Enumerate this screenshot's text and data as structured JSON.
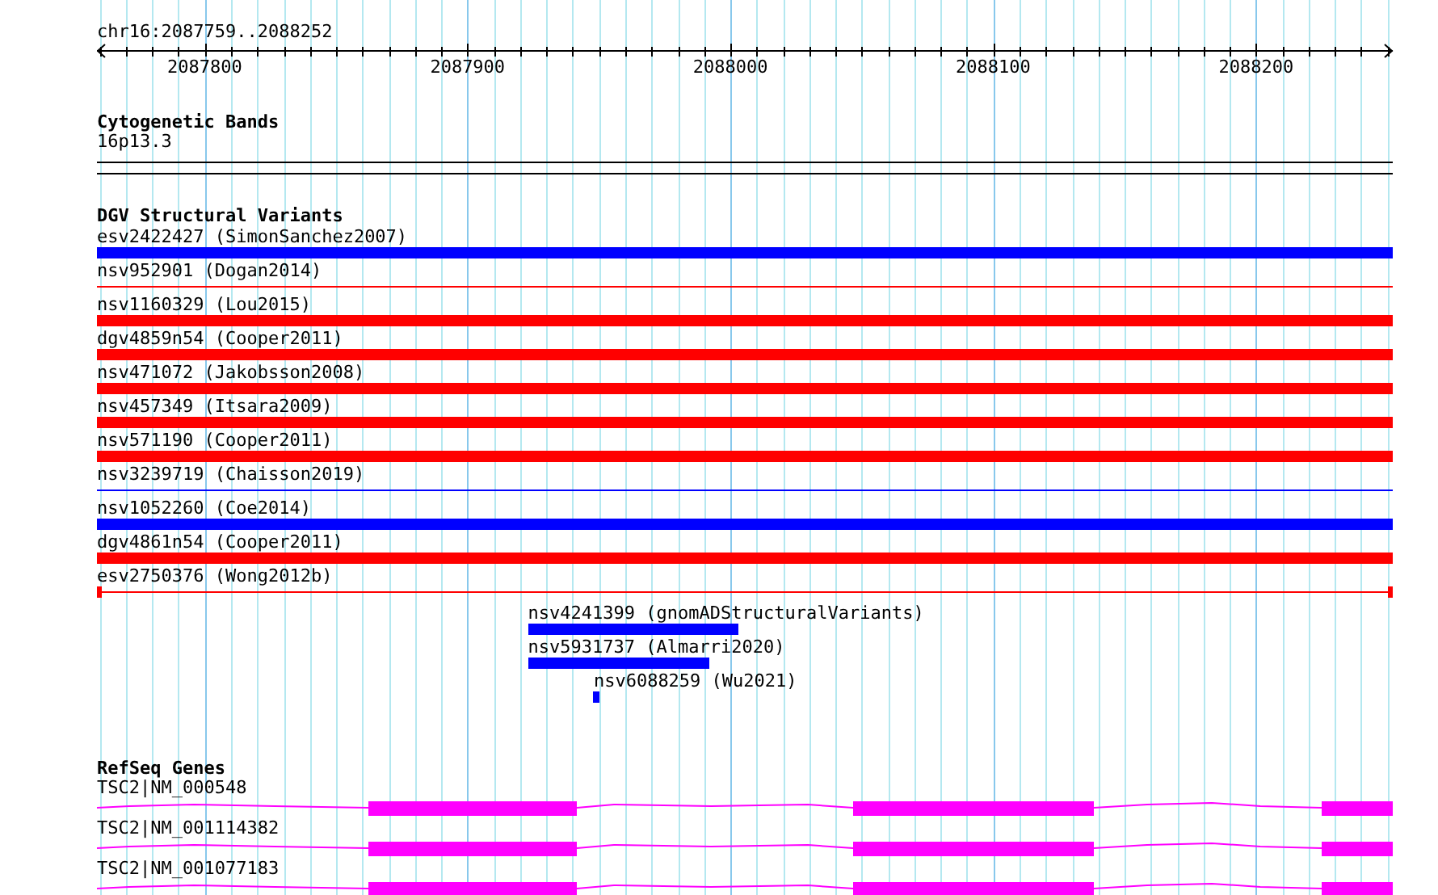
{
  "location": "chr16:2087759..2088252",
  "axis": {
    "ticks": [
      "2087800",
      "2087900",
      "2088000",
      "2088100",
      "2088200"
    ]
  },
  "tracks": [
    {
      "kind": "bands",
      "title": "Cytogenetic Bands",
      "features": [
        {
          "label": "16p13.3"
        }
      ]
    },
    {
      "kind": "variants",
      "title": "DGV Structural Variants",
      "features": [
        {
          "label": "esv2422427 (SimonSanchez2007)",
          "color": "#0000ff",
          "kind": "bar"
        },
        {
          "label": "nsv952901 (Dogan2014)",
          "color": "#ff0000",
          "kind": "line"
        },
        {
          "label": "nsv1160329 (Lou2015)",
          "color": "#ff0000",
          "kind": "bar"
        },
        {
          "label": "dgv4859n54 (Cooper2011)",
          "color": "#ff0000",
          "kind": "bar"
        },
        {
          "label": "nsv471072 (Jakobsson2008)",
          "color": "#ff0000",
          "kind": "bar"
        },
        {
          "label": "nsv457349 (Itsara2009)",
          "color": "#ff0000",
          "kind": "bar"
        },
        {
          "label": "nsv571190 (Cooper2011)",
          "color": "#ff0000",
          "kind": "bar"
        },
        {
          "label": "nsv3239719 (Chaisson2019)",
          "color": "#0000ff",
          "kind": "line"
        },
        {
          "label": "nsv1052260 (Coe2014)",
          "color": "#0000ff",
          "kind": "bar"
        },
        {
          "label": "dgv4861n54 (Cooper2011)",
          "color": "#ff0000",
          "kind": "bar"
        },
        {
          "label": "esv2750376 (Wong2012b)",
          "color": "#ff0000",
          "kind": "line-ended"
        },
        {
          "label": "nsv4241399 (gnomADStructuralVariants)",
          "color": "#0000ff",
          "kind": "bar"
        },
        {
          "label": "nsv5931737 (Almarri2020)",
          "color": "#0000ff",
          "kind": "bar"
        },
        {
          "label": "nsv6088259 (Wu2021)",
          "color": "#0000ff",
          "kind": "bar"
        }
      ]
    },
    {
      "kind": "genes",
      "title": "RefSeq Genes",
      "features": [
        {
          "label": "TSC2|NM_000548"
        },
        {
          "label": "TSC2|NM_001114382"
        },
        {
          "label": "TSC2|NM_001077183"
        }
      ]
    }
  ]
}
